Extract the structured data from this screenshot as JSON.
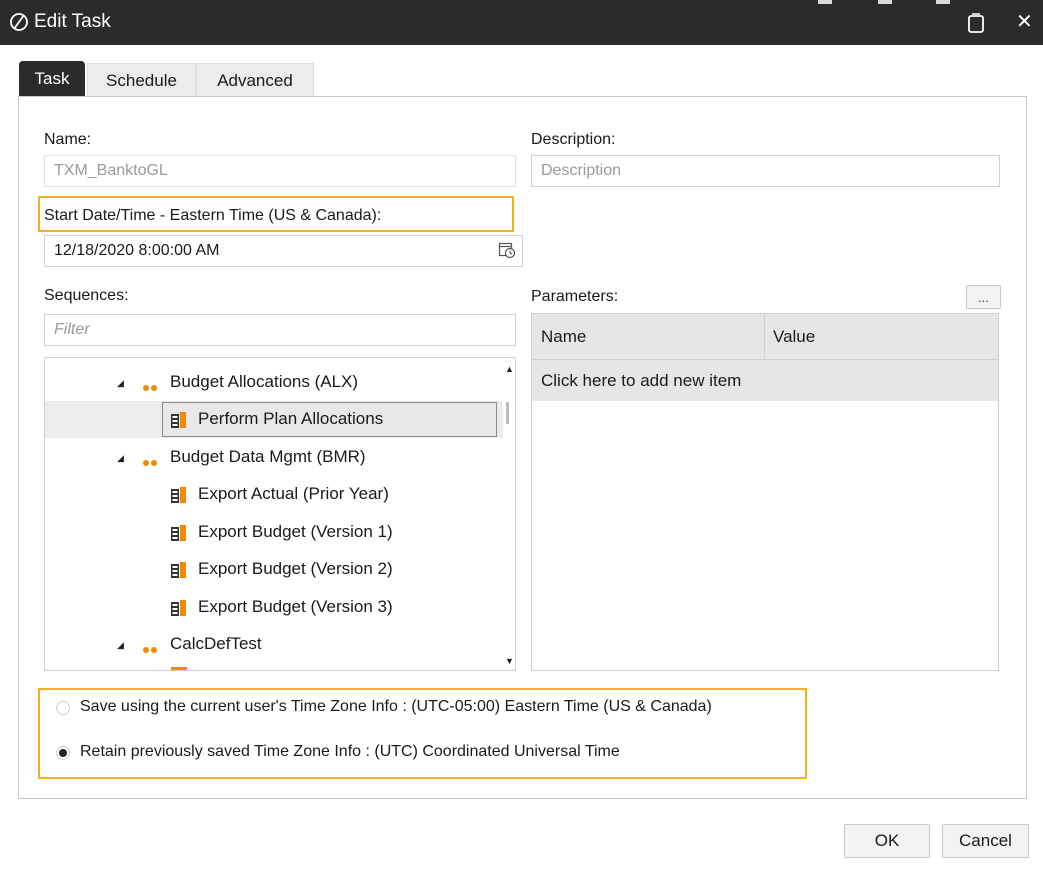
{
  "window": {
    "title": "Edit Task"
  },
  "tabs": [
    {
      "label": "Task"
    },
    {
      "label": "Schedule"
    },
    {
      "label": "Advanced"
    }
  ],
  "form": {
    "name_label": "Name:",
    "name_value": "TXM_BanktoGL",
    "description_label": "Description:",
    "description_placeholder": "Description",
    "start_label": "Start Date/Time - Eastern Time (US & Canada):",
    "start_value": "12/18/2020 8:00:00 AM",
    "sequences_label": "Sequences:",
    "filter_placeholder": "Filter",
    "parameters_label": "Parameters:",
    "ellipsis_label": "...",
    "param_col_name": "Name",
    "param_col_value": "Value",
    "param_add": "Click here to add new item"
  },
  "tree": [
    {
      "label": "Budget Allocations (ALX)",
      "kind": "group"
    },
    {
      "label": "Perform Plan Allocations",
      "kind": "item",
      "selected": true
    },
    {
      "label": "Budget Data Mgmt (BMR)",
      "kind": "group"
    },
    {
      "label": "Export Actual (Prior Year)",
      "kind": "item"
    },
    {
      "label": "Export Budget (Version 1)",
      "kind": "item"
    },
    {
      "label": "Export Budget (Version 2)",
      "kind": "item"
    },
    {
      "label": "Export Budget (Version 3)",
      "kind": "item"
    },
    {
      "label": "CalcDefTest",
      "kind": "group"
    }
  ],
  "timezone": {
    "option1": "Save using the current user's Time Zone Info : (UTC-05:00) Eastern Time (US & Canada)",
    "option2": "Retain previously saved Time Zone Info : (UTC) Coordinated Universal Time",
    "selected": "option2"
  },
  "buttons": {
    "ok": "OK",
    "cancel": "Cancel"
  },
  "colors": {
    "titlebar": "#2b2b2b",
    "highlight": "#f2b01e",
    "group_dot": "#f08a00"
  }
}
